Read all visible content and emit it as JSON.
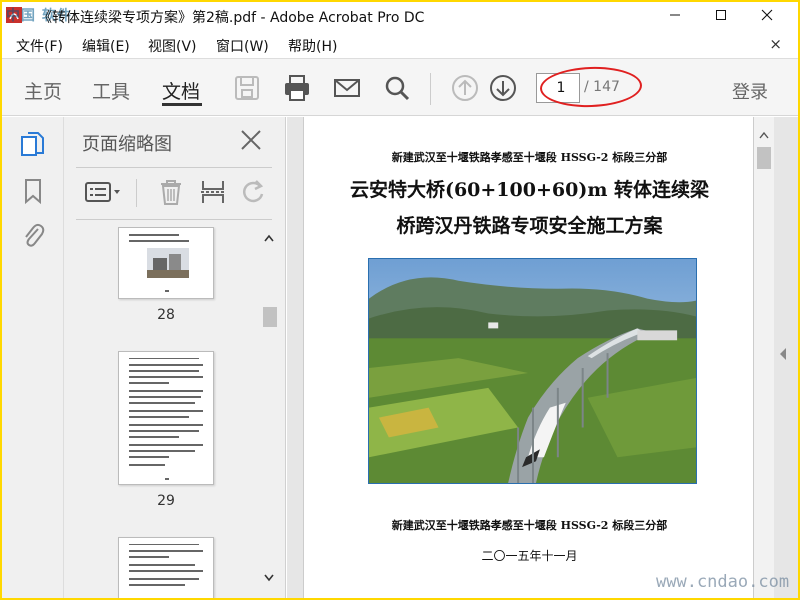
{
  "window": {
    "title": "《转体连续梁专项方案》第2稿.pdf - Adobe Acrobat Pro DC"
  },
  "watermark": {
    "top_left": "中国 软件 ",
    "bottom_right": "www.cndao.com"
  },
  "menu": {
    "items": [
      {
        "label": "文件(F)"
      },
      {
        "label": "编辑(E)"
      },
      {
        "label": "视图(V)"
      },
      {
        "label": "窗口(W)"
      },
      {
        "label": "帮助(H)"
      }
    ],
    "close_glyph": "×"
  },
  "toolbar": {
    "tabs": [
      {
        "label": "主页"
      },
      {
        "label": "工具"
      },
      {
        "label": "文档"
      }
    ],
    "active_tab": "文档",
    "page_current": "1",
    "page_total": "/ 147",
    "login_label": "登录",
    "icons": [
      "save-icon",
      "print-icon",
      "email-icon",
      "search-icon",
      "previous-page-icon",
      "next-page-icon"
    ]
  },
  "left_rail": {
    "icons": [
      "page-thumbnails-icon",
      "bookmark-icon",
      "attachment-icon"
    ]
  },
  "thumbnail_panel": {
    "title": "页面缩略图",
    "tools": [
      "options-menu-icon",
      "delete-icon",
      "extract-icon",
      "rotate-icon"
    ],
    "pages": [
      {
        "number": "28"
      },
      {
        "number": "29"
      },
      {
        "number": ""
      }
    ]
  },
  "document": {
    "header": "新建武汉至十堰铁路孝感至十堰段 HSSG-2 标段三分部",
    "title_line1": "云安特大桥(60+100+60)m 转体连续梁",
    "title_line2": "桥跨汉丹铁路专项安全施工方案",
    "footer_line1": "新建武汉至十堰铁路孝感至十堰段 HSSG-2 标段三分部",
    "footer_line2": "二〇一五年十一月",
    "photo": "high-speed-train-on-viaduct-photo"
  },
  "colors": {
    "highlight_ellipse": "#e02020",
    "accent_blue": "#2a7ad6",
    "frame": "#ffd800"
  }
}
